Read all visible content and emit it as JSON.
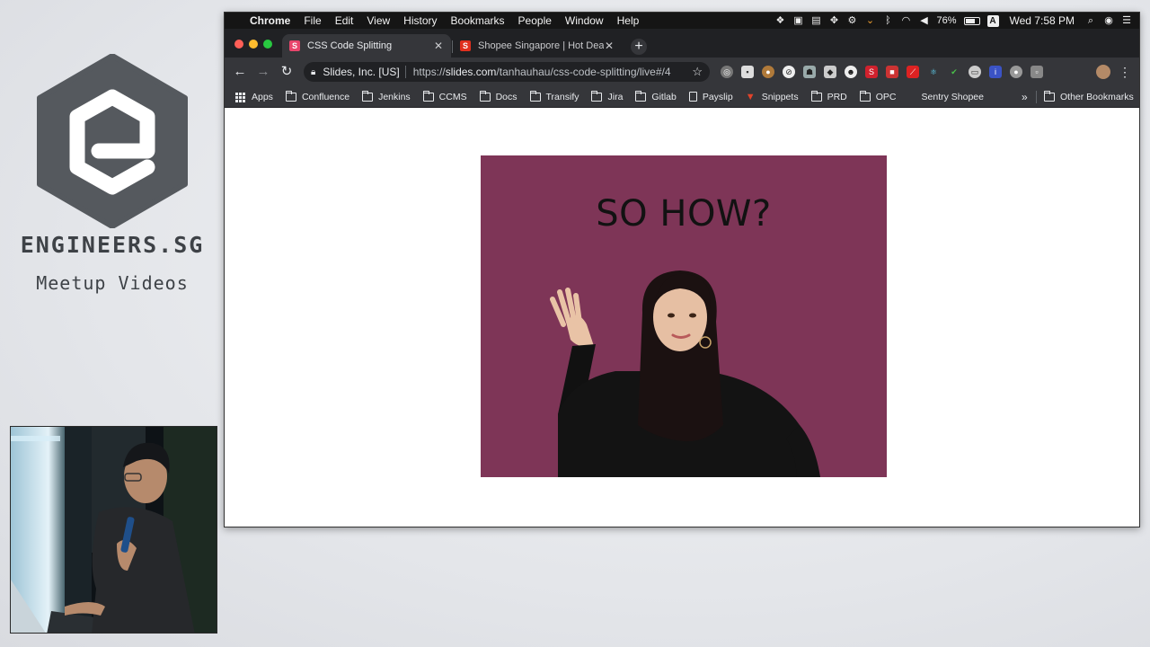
{
  "brand": {
    "name": "ENGINEERS.SG",
    "subtitle": "Meetup Videos",
    "logo_color": "#55595e"
  },
  "menubar": {
    "app": "Chrome",
    "menus": [
      "File",
      "Edit",
      "View",
      "History",
      "Bookmarks",
      "People",
      "Window",
      "Help"
    ],
    "battery": "76%",
    "battery_level": 0.76,
    "input_source": "A",
    "clock": "Wed 7:58 PM"
  },
  "tabs": [
    {
      "title": "CSS Code Splitting",
      "favicon": "S",
      "favicon_color": "#e8456b",
      "active": true
    },
    {
      "title": "Shopee Singapore | Hot Deals",
      "favicon": "S",
      "favicon_color": "#e0301e",
      "active": false
    }
  ],
  "omnibox": {
    "org": "Slides, Inc. [US]",
    "url_prefix": "https://",
    "url_host": "slides.com",
    "url_path": "/tanhauhau/css-code-splitting/live#/4"
  },
  "bookmarks": {
    "items": [
      {
        "label": "Apps",
        "icon": "apps-grid-icon"
      },
      {
        "label": "Confluence",
        "icon": "folder-icon"
      },
      {
        "label": "Jenkins",
        "icon": "folder-icon"
      },
      {
        "label": "CCMS",
        "icon": "folder-icon"
      },
      {
        "label": "Docs",
        "icon": "folder-icon"
      },
      {
        "label": "Transify",
        "icon": "folder-icon"
      },
      {
        "label": "Jira",
        "icon": "folder-icon"
      },
      {
        "label": "Gitlab",
        "icon": "folder-icon"
      },
      {
        "label": "Payslip",
        "icon": "page-icon"
      },
      {
        "label": "Snippets",
        "icon": "gitlab-fox-icon"
      },
      {
        "label": "PRD",
        "icon": "folder-icon"
      },
      {
        "label": "OPC",
        "icon": "folder-icon"
      },
      {
        "label": "Sentry Shopee",
        "icon": "none"
      }
    ],
    "more": "»",
    "other": "Other Bookmarks"
  },
  "slide": {
    "title": "SO HOW?",
    "background": "#7e3557"
  }
}
